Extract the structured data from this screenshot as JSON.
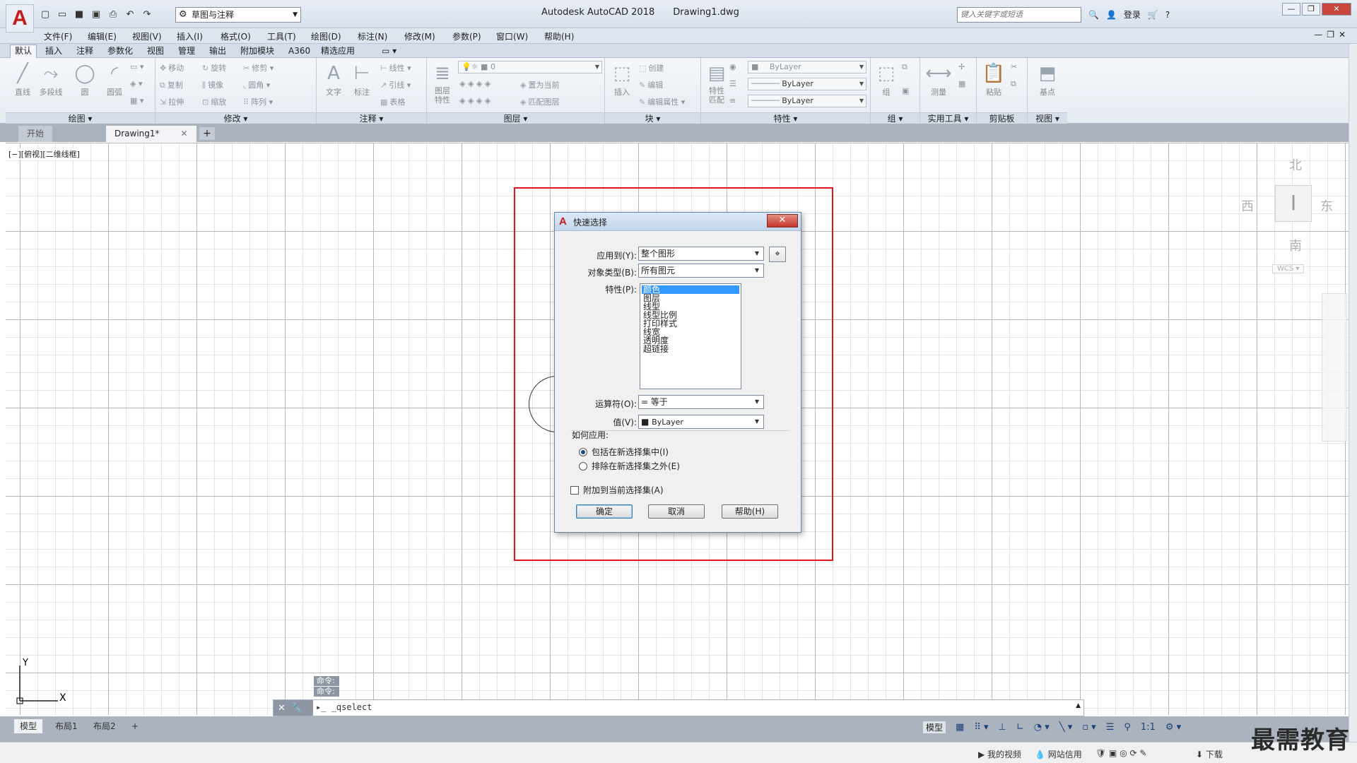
{
  "titlebar": {
    "workspace": "草图与注释",
    "app_title": "Autodesk AutoCAD 2018",
    "file_name": "Drawing1.dwg",
    "search_placeholder": "键入关键字或短语",
    "login": "登录"
  },
  "menubar": [
    "文件(F)",
    "编辑(E)",
    "视图(V)",
    "插入(I)",
    "格式(O)",
    "工具(T)",
    "绘图(D)",
    "标注(N)",
    "修改(M)",
    "参数(P)",
    "窗口(W)",
    "帮助(H)"
  ],
  "ribbon_tabs": [
    "默认",
    "插入",
    "注释",
    "参数化",
    "视图",
    "管理",
    "输出",
    "附加模块",
    "A360",
    "精选应用"
  ],
  "ribbon": {
    "draw": {
      "title": "绘图",
      "line": "直线",
      "polyline": "多段线",
      "circle": "圆",
      "arc": "圆弧"
    },
    "modify": {
      "title": "修改",
      "move": "移动",
      "rotate": "旋转",
      "trim": "修剪",
      "copy": "复制",
      "mirror": "镜像",
      "fillet": "圆角",
      "stretch": "拉伸",
      "scale": "缩放",
      "array": "阵列"
    },
    "annotation": {
      "title": "注释",
      "text": "文字",
      "dimension": "标注",
      "linear": "线性",
      "leader": "引线",
      "table": "表格"
    },
    "layers": {
      "title": "图层",
      "layer_props": "图层特性",
      "current_layer": "0",
      "set_current": "置为当前",
      "match_layer": "匹配图层"
    },
    "block": {
      "title": "块",
      "insert": "插入",
      "create": "创建",
      "edit": "编辑",
      "edit_attr": "编辑属性"
    },
    "properties": {
      "title": "特性",
      "match": "特性匹配",
      "color": "ByLayer",
      "linetype": "ByLayer",
      "lineweight": "ByLayer"
    },
    "groups": {
      "title": "组",
      "group": "组"
    },
    "utilities": {
      "title": "实用工具",
      "measure": "测量"
    },
    "clipboard": {
      "title": "剪贴板",
      "paste": "粘贴"
    },
    "view": {
      "title": "视图",
      "base": "基点"
    }
  },
  "file_tabs": {
    "start": "开始",
    "drawing": "Drawing1*"
  },
  "viewport_label": "[−][俯视][二维线框]",
  "viewcube": {
    "north": "北",
    "south": "南",
    "east": "东",
    "west": "西",
    "wcs": "WCS"
  },
  "ucs": {
    "x": "X",
    "y": "Y"
  },
  "dialog": {
    "title": "快速选择",
    "apply_to_label": "应用到(Y):",
    "apply_to_value": "整个图形",
    "object_type_label": "对象类型(B):",
    "object_type_value": "所有图元",
    "properties_label": "特性(P):",
    "properties": [
      "颜色",
      "图层",
      "线型",
      "线型比例",
      "打印样式",
      "线宽",
      "透明度",
      "超链接"
    ],
    "operator_label": "运算符(O):",
    "operator_value": "= 等于",
    "value_label": "值(V):",
    "value_value": "ByLayer",
    "how_apply_label": "如何应用:",
    "include_option": "包括在新选择集中(I)",
    "exclude_option": "排除在新选择集之外(E)",
    "append_label": "附加到当前选择集(A)",
    "ok": "确定",
    "cancel": "取消",
    "help": "帮助(H)"
  },
  "command": {
    "history": [
      "命令:",
      "命令:"
    ],
    "current": "_qselect"
  },
  "layout_tabs": [
    "模型",
    "布局1",
    "布局2"
  ],
  "status": {
    "model": "模型",
    "scale": "1:1"
  },
  "bottom_bar": {
    "video": "我的视频",
    "net": "网站信用",
    "download": "下载"
  },
  "watermark": "最需教育"
}
